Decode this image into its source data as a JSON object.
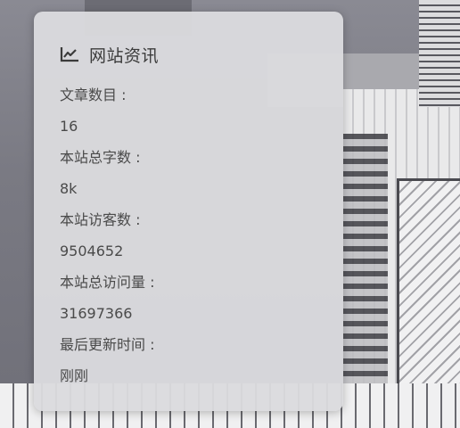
{
  "card": {
    "title": "网站资讯",
    "icon": "chart-line-icon"
  },
  "stats": [
    {
      "label": "文章数目 :",
      "value": "16"
    },
    {
      "label": "本站总字数 :",
      "value": "8k"
    },
    {
      "label": "本站访客数 :",
      "value": "9504652"
    },
    {
      "label": "本站总访问量 :",
      "value": "31697366"
    },
    {
      "label": "最后更新时间 :",
      "value": "刚刚"
    }
  ],
  "colors": {
    "card_background": "#dbdbde",
    "text": "#4a4a4a",
    "title": "#3b3b3b"
  }
}
